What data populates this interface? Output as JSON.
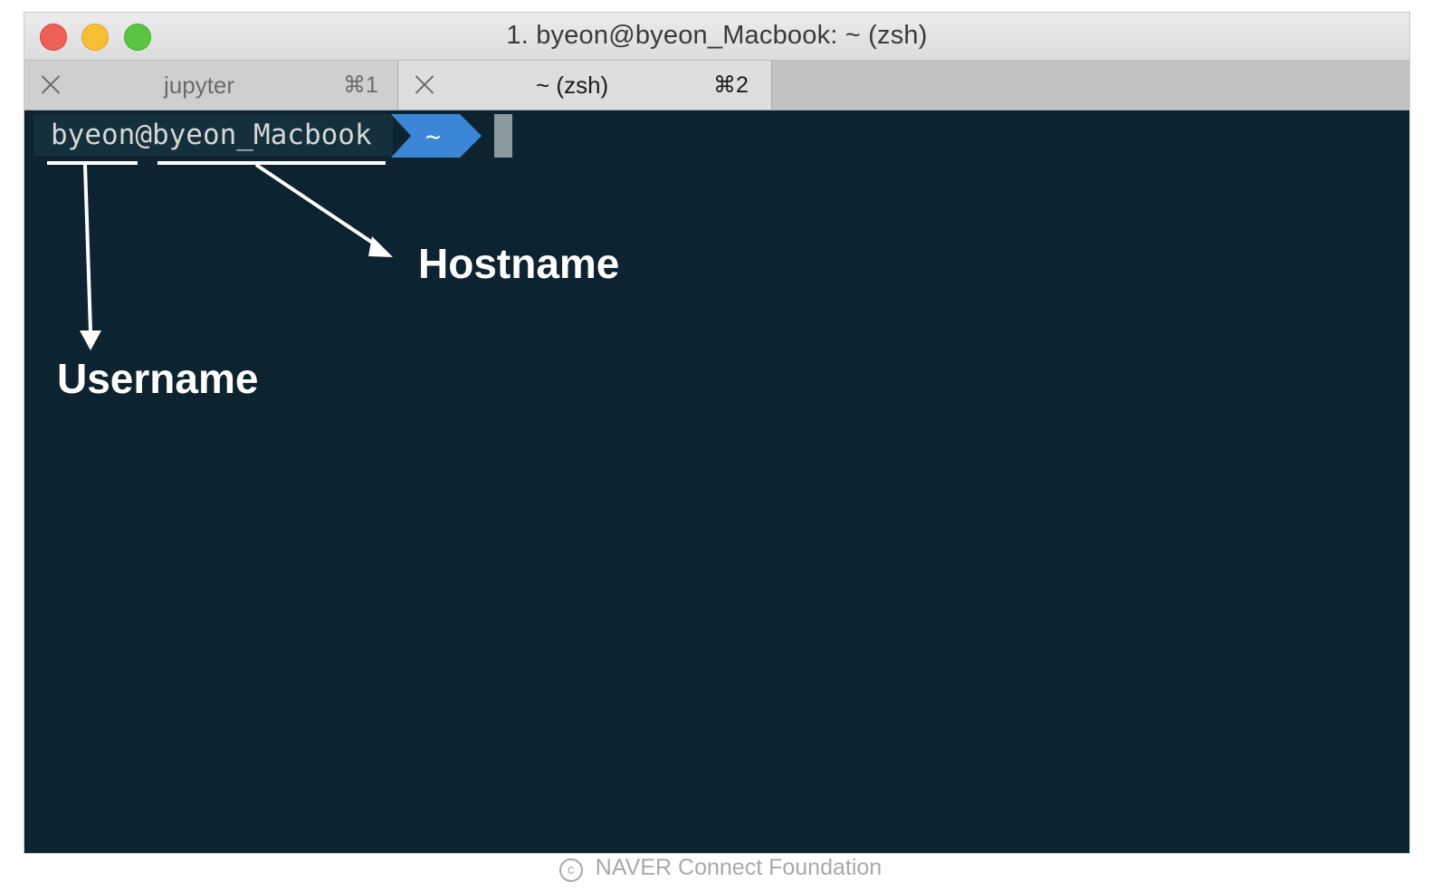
{
  "window": {
    "title": "1. byeon@byeon_Macbook: ~ (zsh)"
  },
  "tabs": [
    {
      "label": "jupyter",
      "shortcut": "⌘1",
      "active": false
    },
    {
      "label": "~ (zsh)",
      "shortcut": "⌘2",
      "active": true
    }
  ],
  "terminal": {
    "prompt": "byeon@byeon_Macbook",
    "directory": "~",
    "background_color": "#0d2430",
    "directory_segment_color": "#3b86d6"
  },
  "annotations": {
    "hostname_label": "Hostname",
    "username_label": "Username"
  },
  "footer": {
    "copyright_symbol": "c",
    "text": "NAVER Connect Foundation"
  }
}
